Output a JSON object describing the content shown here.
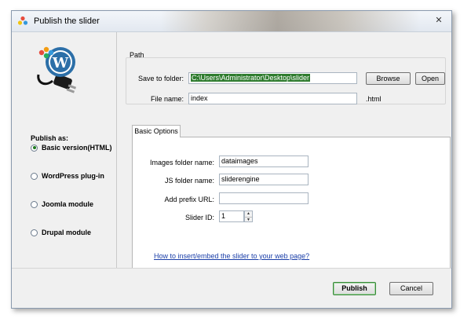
{
  "window": {
    "title": "Publish the slider",
    "close_glyph": "✕"
  },
  "sidebar": {
    "publish_as_label": "Publish as:",
    "options": [
      {
        "label": "Basic version(HTML)",
        "selected": true
      },
      {
        "label": "WordPress plug-in",
        "selected": false
      },
      {
        "label": "Joomla module",
        "selected": false
      },
      {
        "label": "Drupal module",
        "selected": false
      }
    ]
  },
  "path": {
    "group_title": "Path",
    "save_to_label": "Save to folder:",
    "save_to_value": "C:\\Users\\Administrator\\Desktop\\slider",
    "browse_label": "Browse",
    "open_label": "Open",
    "file_name_label": "File name:",
    "file_name_value": "index",
    "extension": ".html"
  },
  "basic_options": {
    "tab_label": "Basic Options",
    "images_folder_label": "Images folder name:",
    "images_folder_value": "dataimages",
    "js_folder_label": "JS folder name:",
    "js_folder_value": "sliderengine",
    "prefix_url_label": "Add prefix URL:",
    "prefix_url_value": "",
    "slider_id_label": "Slider ID:",
    "slider_id_value": "1",
    "help_link": "How to insert/embed the slider to your web page?"
  },
  "footer": {
    "publish_label": "Publish",
    "cancel_label": "Cancel"
  },
  "colors": {
    "selection": "#2f7c2f",
    "link": "#1a3ea8",
    "radio_dot": "#1f7a1f"
  }
}
